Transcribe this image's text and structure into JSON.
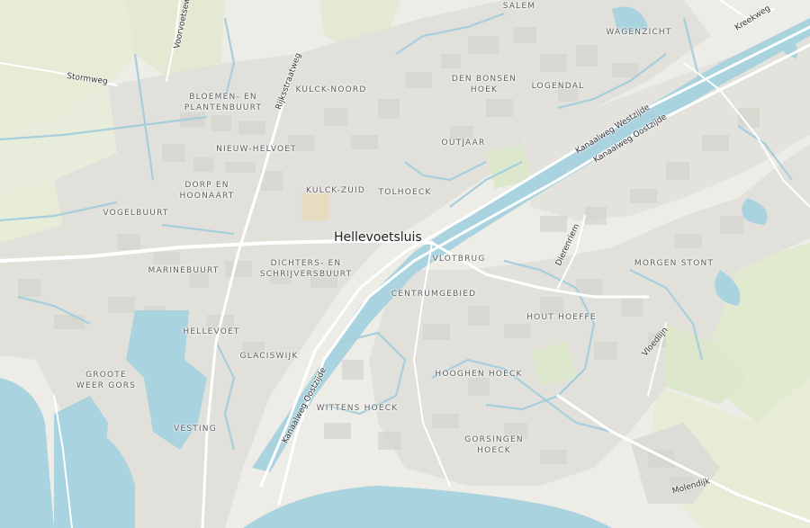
{
  "map": {
    "city_label": "Hellevoetsluis",
    "colors": {
      "land": "#eeece6",
      "built": "#e1dfda",
      "block": "#d6d4ce",
      "water": "#a9d3df",
      "canal": "#a6cfdb",
      "field": "#e6ecd6",
      "park": "#dfe8cf",
      "road": "#ffffff",
      "label": "#5e5e5e"
    },
    "neighborhoods": [
      {
        "id": "salem",
        "lines": [
          "SALEM"
        ]
      },
      {
        "id": "wagenzicht",
        "lines": [
          "WAGENZICHT"
        ]
      },
      {
        "id": "den-bonsen-hoek",
        "lines": [
          "DEN BONSEN",
          "HOEK"
        ]
      },
      {
        "id": "logendal",
        "lines": [
          "LOGENDAL"
        ]
      },
      {
        "id": "bloemen-en-plantenbuurt",
        "lines": [
          "BLOEMEN- EN",
          "PLANTENBUURT"
        ]
      },
      {
        "id": "kulck-noord",
        "lines": [
          "KULCK-NOORD"
        ]
      },
      {
        "id": "nieuw-helvoet",
        "lines": [
          "NIEUW-HELVOET"
        ]
      },
      {
        "id": "outjaar",
        "lines": [
          "OUTJAAR"
        ]
      },
      {
        "id": "dorp-en-hoonaart",
        "lines": [
          "DORP EN",
          "HOONAART"
        ]
      },
      {
        "id": "kulck-zuid",
        "lines": [
          "KULCK-ZUID"
        ]
      },
      {
        "id": "tolhoeck",
        "lines": [
          "TOLHOECK"
        ]
      },
      {
        "id": "vogelbuurt",
        "lines": [
          "VOGELBUURT"
        ]
      },
      {
        "id": "vlotbrug",
        "lines": [
          "VLOTBRUG"
        ]
      },
      {
        "id": "morgen-stont",
        "lines": [
          "MORGEN STONT"
        ]
      },
      {
        "id": "marinebuurt",
        "lines": [
          "MARINEBUURT"
        ]
      },
      {
        "id": "dichters-en-schrijversbuurt",
        "lines": [
          "DICHTERS- EN",
          "SCHRIJVERSBUURT"
        ]
      },
      {
        "id": "centrumgebied",
        "lines": [
          "CENTRUMGEBIED"
        ]
      },
      {
        "id": "hout-hoeffe",
        "lines": [
          "HOUT HOEFFE"
        ]
      },
      {
        "id": "hellevoet",
        "lines": [
          "HELLEVOET"
        ]
      },
      {
        "id": "glaciswijk",
        "lines": [
          "GLACISWIJK"
        ]
      },
      {
        "id": "groote-weer-gors",
        "lines": [
          "GROOTE",
          "WEER GORS"
        ]
      },
      {
        "id": "hooghen-hoeck",
        "lines": [
          "HOOGHEN HOECK"
        ]
      },
      {
        "id": "wittens-hoeck",
        "lines": [
          "WITTENS HOECK"
        ]
      },
      {
        "id": "vesting",
        "lines": [
          "VESTING"
        ]
      },
      {
        "id": "gorsingen-hoeck",
        "lines": [
          "GORSINGEN",
          "HOECK"
        ]
      }
    ],
    "streets": [
      {
        "id": "voorvoetsewe",
        "text": "Voorvoetsewe"
      },
      {
        "id": "stormweg",
        "text": "Stormweg"
      },
      {
        "id": "rijksstraatweg",
        "text": "Rijksstraatweg"
      },
      {
        "id": "kreekweg",
        "text": "Kreekweg"
      },
      {
        "id": "kanaalweg-westzijde",
        "text": "Kanaalweg Westzijde"
      },
      {
        "id": "kanaalweg-oostzijde-north",
        "text": "Kanaalweg Oostzijde"
      },
      {
        "id": "dierenriem",
        "text": "Dierenriem"
      },
      {
        "id": "vloedlijn",
        "text": "Vloedlijn"
      },
      {
        "id": "kanaalweg-oostzijde-south",
        "text": "Kanaalweg Oostzijde"
      },
      {
        "id": "molendijk",
        "text": "Molendijk"
      }
    ]
  }
}
